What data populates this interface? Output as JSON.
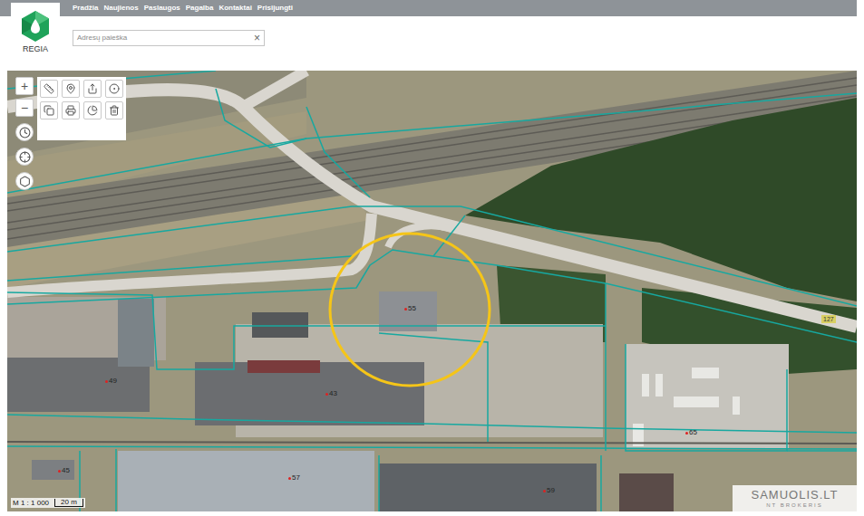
{
  "logo": "REGIA",
  "nav": [
    "Pradžia",
    "Naujienos",
    "Paslaugos",
    "Pagalba",
    "Kontaktai",
    "Prisijungti"
  ],
  "search": {
    "placeholder": "Adresų paieška",
    "clear": "×"
  },
  "tools": {
    "zoom_in": "+",
    "zoom_out": "−"
  },
  "map": {
    "parcel_labels": [
      "55",
      "49",
      "43",
      "65",
      "45",
      "57",
      "59"
    ],
    "road_label": "127",
    "scale": "M 1 : 1 000",
    "scale_bar": "20 m"
  },
  "watermark": {
    "title": "SAMUOLIS.LT",
    "subtitle": "NT BROKERIS"
  }
}
